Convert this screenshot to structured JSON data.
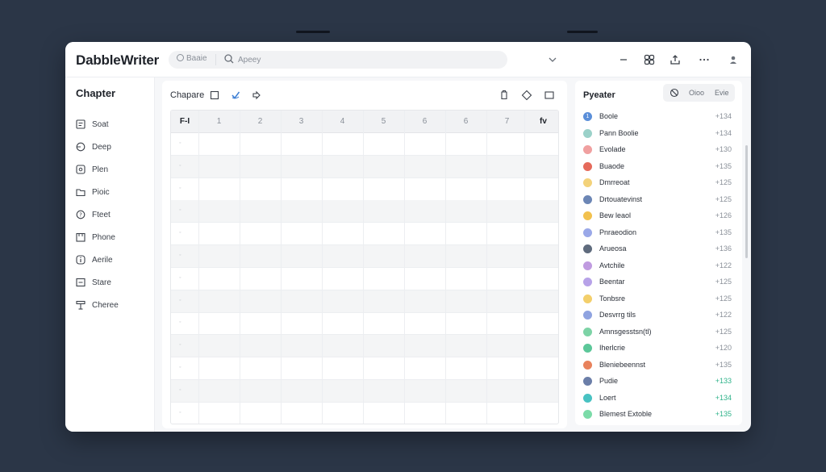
{
  "app": {
    "title": "DabbleWriter"
  },
  "search": {
    "chip_label": "Baaie",
    "placeholder": "Apeey"
  },
  "toolbar": {
    "icons": [
      "chevron-down-icon",
      "minus-icon",
      "link-icon",
      "share-icon",
      "more-icon",
      "user-icon"
    ]
  },
  "sidebar": {
    "title": "Chapter",
    "items": [
      {
        "label": "Soat",
        "icon": "document-icon"
      },
      {
        "label": "Deep",
        "icon": "circle-icon"
      },
      {
        "label": "Plen",
        "icon": "plan-icon"
      },
      {
        "label": "Pioic",
        "icon": "folder-icon"
      },
      {
        "label": "Fteet",
        "icon": "help-icon"
      },
      {
        "label": "Phone",
        "icon": "box-icon"
      },
      {
        "label": "Aerile",
        "icon": "info-icon"
      },
      {
        "label": "Stare",
        "icon": "minus-box-icon"
      },
      {
        "label": "Cheree",
        "icon": "table-icon"
      }
    ]
  },
  "main": {
    "title": "Chapare",
    "grid": {
      "first_header": "F-I",
      "headers": [
        "1",
        "2",
        "3",
        "4",
        "5",
        "6",
        "6",
        "7"
      ],
      "last_header": "fv",
      "row_count": 13
    }
  },
  "right_panel": {
    "title": "Pyeater",
    "segment": {
      "a": "Oioo",
      "b": "Evie"
    },
    "items": [
      {
        "name": "Boole",
        "count": "+134",
        "color": "#5b8fd9",
        "mark": "1"
      },
      {
        "name": "Pann Boolie",
        "count": "+134",
        "color": "#9bd1c9",
        "mark": ""
      },
      {
        "name": "Evolade",
        "count": "+130",
        "color": "#f0a0a0",
        "mark": ""
      },
      {
        "name": "Buaode",
        "count": "+135",
        "color": "#e56a5b",
        "mark": ""
      },
      {
        "name": "Dmrreoat",
        "count": "+125",
        "color": "#f3d27a",
        "mark": ""
      },
      {
        "name": "Drtouatevinst",
        "count": "+125",
        "color": "#6c86b5",
        "mark": ""
      },
      {
        "name": "Bew leaol",
        "count": "+126",
        "color": "#f2c14e",
        "mark": ""
      },
      {
        "name": "Pnraeodion",
        "count": "+135",
        "color": "#9aa8e8",
        "mark": ""
      },
      {
        "name": "Arueosa",
        "count": "+136",
        "color": "#5f6b7d",
        "mark": ""
      },
      {
        "name": "Avtchile",
        "count": "+122",
        "color": "#c09be0",
        "mark": ""
      },
      {
        "name": "Beentar",
        "count": "+125",
        "color": "#b7a2e8",
        "mark": ""
      },
      {
        "name": "Tonbsre",
        "count": "+125",
        "color": "#f3cf6b",
        "mark": ""
      },
      {
        "name": "Desvrrg tils",
        "count": "+122",
        "color": "#8fa3e0",
        "mark": ""
      },
      {
        "name": "Amnsgesstsn(tl)",
        "count": "+125",
        "color": "#7dd3a6",
        "mark": ""
      },
      {
        "name": "Iherlcrie",
        "count": "+120",
        "color": "#5cc799",
        "mark": ""
      },
      {
        "name": "Bleniebeennst",
        "count": "+135",
        "color": "#e8825c",
        "mark": ""
      },
      {
        "name": "Pudie",
        "count": "+133",
        "color": "#6b7ea8",
        "mark": ""
      },
      {
        "name": "Loert",
        "count": "+134",
        "color": "#48c2c2",
        "mark": ""
      },
      {
        "name": "Blemest Extoble",
        "count": "+135",
        "color": "#7bdba8",
        "mark": ""
      }
    ]
  }
}
